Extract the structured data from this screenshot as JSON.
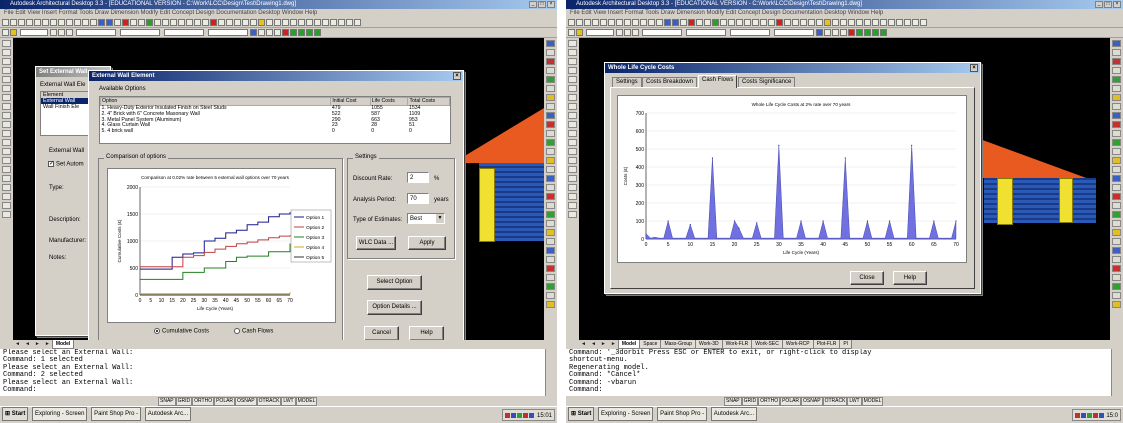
{
  "left": {
    "app_title": "Autodesk Architectural Desktop 3.3 - [EDUCATIONAL VERSION - C:\\Work\\LCC\\Design\\Test\\Drawing1.dwg]",
    "menu": "File  Edit  View  Insert  Format  Tools  Draw  Dimension  Modify  Edit  Concept  Design  Documentation  Desktop  Window  Help",
    "bg_dialog": {
      "title": "Set External Wall",
      "rows": [
        "External Wall Ele",
        "Element",
        "External Wall",
        "Wall Finish Ele"
      ],
      "external_wall_label": "External Wall",
      "set_auto": "Set Autom",
      "type_label": "Type:",
      "description_label": "Description:",
      "manufacturer_label": "Manufacturer:",
      "notes_label": "Notes:"
    },
    "dialog": {
      "title": "External Wall Element",
      "available_options": "Available Options",
      "headers": [
        "Option",
        "Initial Cost",
        "Life Costs",
        "Total Costs"
      ],
      "options": [
        {
          "num": "1.",
          "name": "Heavy-Duty Exterior Insulated Finish on Steel Studs",
          "initial": "479",
          "life": "1055",
          "total": "1534"
        },
        {
          "num": "2.",
          "name": "4\" Brick with 6\" Concrete Masonary Wall",
          "initial": "522",
          "life": "587",
          "total": "1109"
        },
        {
          "num": "3.",
          "name": "Metal Panel System (Aluminum)",
          "initial": "290",
          "life": "663",
          "total": "953"
        },
        {
          "num": "4.",
          "name": "Glass Curtain Wall",
          "initial": "23",
          "life": "28",
          "total": "51"
        },
        {
          "num": "5.",
          "name": "4 brick wall",
          "initial": "0",
          "life": "0",
          "total": "0"
        }
      ],
      "comparison_group": "Comparison of options",
      "settings_group": "Settings",
      "discount_rate_label": "Discount Rate:",
      "discount_rate_value": "2",
      "discount_rate_unit": "%",
      "analysis_period_label": "Analysis Period:",
      "analysis_period_value": "70",
      "analysis_period_unit": "years",
      "type_estimates_label": "Type of Estimates:",
      "type_estimates_value": "Best",
      "wlc_data_button": "WLC Data ...",
      "apply_button": "Apply",
      "select_option_button": "Select Option",
      "option_details_button": "Option Details ...",
      "cancel_button": "Cancel",
      "help_button": "Help",
      "radio_cumulative": "Cumulative Costs",
      "radio_cashflows": "Cash Flows"
    },
    "tabs": [
      "◄",
      "◄",
      "►",
      "►",
      "Model"
    ],
    "command_lines": [
      "Please select an External Wall:",
      "Command: 1 selected",
      "Please select an External Wall:",
      "Command: 2 selected",
      "Please select an External Wall:",
      "Command:"
    ],
    "status": [
      "SNAP",
      "GRID",
      "ORTHO",
      "POLAR",
      "OSNAP",
      "OTRACK",
      "LWT",
      "MODEL"
    ],
    "taskbar": {
      "start": "Start",
      "buttons": [
        "Exploring - Screen",
        "Paint Shop Pro -",
        "Autodesk Arc..."
      ],
      "clock": "15:01"
    }
  },
  "right": {
    "app_title": "Autodesk Architectural Desktop 3.3 - [EDUCATIONAL VERSION - C:\\Work\\LCC\\Design\\Test\\Drawing1.dwg]",
    "menu": "File  Edit  View  Insert  Format  Tools  Draw  Dimension  Modify  Edit  Concept  Design  Documentation  Desktop  Window  Help",
    "dialog": {
      "title": "Whole Life Cycle Costs",
      "tabs": [
        "Settings",
        "Costs Breakdown",
        "Cash Flows",
        "Costs Significance"
      ],
      "active_tab": "Cash Flows",
      "close_button": "Close",
      "help_button": "Help"
    },
    "tabs": [
      "◄",
      "◄",
      "►",
      "►",
      "Model",
      "Space",
      "Mass-Group",
      "Work-3D",
      "Work-FLR",
      "Work-SEC",
      "Work-RCP",
      "Plot-FLR",
      "Pl"
    ],
    "command_lines": [
      "Command: '_3dorbit Press ESC or ENTER to exit, or right-click to display",
      "shortcut-menu.",
      "Regenerating model.",
      "Command: *Cancel*",
      "Command: -vbarun",
      "Command:"
    ],
    "status": [
      "SNAP",
      "GRID",
      "ORTHO",
      "POLAR",
      "OSNAP",
      "OTRACK",
      "LWT",
      "MODEL"
    ],
    "taskbar": {
      "start": "Start",
      "buttons": [
        "Exploring - Screen",
        "Paint Shop Pro -",
        "Autodesk Arc..."
      ],
      "clock": "15:0"
    }
  },
  "chart_data": [
    {
      "type": "line",
      "title": "Comparison at 0.02% rate between 5 external wall options over 70 years",
      "xlabel": "Life Cycle (Years)",
      "ylabel": "Cumulative Costs (£)",
      "xlim": [
        0,
        70
      ],
      "ylim": [
        0,
        2000
      ],
      "xticks": [
        0,
        5,
        10,
        15,
        20,
        25,
        30,
        35,
        40,
        45,
        50,
        55,
        60,
        65,
        70
      ],
      "yticks": [
        0,
        500,
        1000,
        1500,
        2000
      ],
      "series": [
        {
          "name": "Option 1",
          "color": "#1a1a8a",
          "x": [
            0,
            10,
            15,
            20,
            25,
            30,
            35,
            40,
            45,
            50,
            55,
            60,
            65,
            70
          ],
          "y": [
            479,
            479,
            700,
            760,
            780,
            1000,
            1050,
            1150,
            1200,
            1300,
            1350,
            1450,
            1500,
            1534
          ]
        },
        {
          "name": "Option 2",
          "color": "#c04040",
          "x": [
            0,
            15,
            20,
            25,
            30,
            35,
            40,
            45,
            50,
            55,
            60,
            65,
            70
          ],
          "y": [
            522,
            522,
            700,
            730,
            790,
            850,
            900,
            950,
            980,
            1020,
            1060,
            1090,
            1109
          ]
        },
        {
          "name": "Option 3",
          "color": "#208020",
          "x": [
            0,
            15,
            20,
            30,
            40,
            45,
            50,
            60,
            70
          ],
          "y": [
            290,
            290,
            420,
            500,
            620,
            700,
            720,
            800,
            953
          ]
        },
        {
          "name": "Option 4",
          "color": "#e0a020",
          "x": [
            0,
            70
          ],
          "y": [
            23,
            51
          ]
        },
        {
          "name": "Option 5",
          "color": "#303030",
          "x": [
            0,
            70
          ],
          "y": [
            0,
            0
          ]
        }
      ],
      "legend": "right"
    },
    {
      "type": "area",
      "title": "Whole Life Cycle Costs at 2% rate over 70 years",
      "xlabel": "Life Cycle (Years)",
      "ylabel": "Costs (£)",
      "xlim": [
        0,
        70
      ],
      "ylim": [
        0,
        700
      ],
      "xticks": [
        0,
        5,
        10,
        15,
        20,
        25,
        30,
        35,
        40,
        45,
        50,
        55,
        60,
        65,
        70
      ],
      "yticks": [
        0,
        100,
        200,
        300,
        400,
        500,
        600,
        700
      ],
      "color": "#7070e0",
      "x": [
        0,
        1,
        2,
        3,
        4,
        5,
        6,
        7,
        8,
        9,
        10,
        11,
        12,
        13,
        14,
        15,
        16,
        17,
        18,
        19,
        20,
        21,
        22,
        23,
        24,
        25,
        26,
        27,
        28,
        29,
        30,
        31,
        32,
        33,
        34,
        35,
        36,
        37,
        38,
        39,
        40,
        41,
        42,
        43,
        44,
        45,
        46,
        47,
        48,
        49,
        50,
        51,
        52,
        53,
        54,
        55,
        56,
        57,
        58,
        59,
        60,
        61,
        62,
        63,
        64,
        65,
        66,
        67,
        68,
        69,
        70
      ],
      "y": [
        30,
        5,
        10,
        5,
        5,
        100,
        5,
        5,
        5,
        5,
        80,
        5,
        5,
        5,
        5,
        450,
        5,
        5,
        5,
        5,
        100,
        60,
        5,
        5,
        5,
        90,
        5,
        5,
        5,
        5,
        520,
        5,
        5,
        5,
        5,
        100,
        5,
        5,
        5,
        5,
        100,
        5,
        5,
        5,
        5,
        450,
        5,
        5,
        5,
        5,
        100,
        5,
        5,
        5,
        5,
        100,
        5,
        5,
        5,
        5,
        520,
        5,
        5,
        5,
        5,
        100,
        5,
        5,
        5,
        5,
        100
      ]
    }
  ]
}
